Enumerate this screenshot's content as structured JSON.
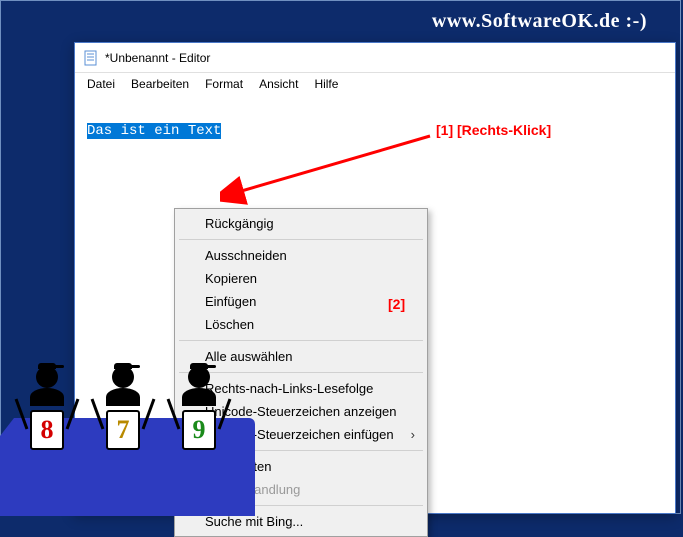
{
  "watermark": "www.SoftwareOK.de :-)",
  "window": {
    "title": "*Unbenannt - Editor"
  },
  "menubar": {
    "items": [
      "Datei",
      "Bearbeiten",
      "Format",
      "Ansicht",
      "Hilfe"
    ]
  },
  "editor": {
    "selected_text": "Das ist ein Text"
  },
  "context_menu": {
    "items": [
      {
        "label": "Rückgängig",
        "enabled": true
      },
      {
        "sep": true
      },
      {
        "label": "Ausschneiden",
        "enabled": true
      },
      {
        "label": "Kopieren",
        "enabled": true
      },
      {
        "label": "Einfügen",
        "enabled": true
      },
      {
        "label": "Löschen",
        "enabled": true
      },
      {
        "sep": true
      },
      {
        "label": "Alle auswählen",
        "enabled": true
      },
      {
        "sep": true
      },
      {
        "label": "Rechts-nach-Links-Lesefolge",
        "enabled": true
      },
      {
        "label": "Unicode-Steuerzeichen anzeigen",
        "enabled": true
      },
      {
        "label": "Unicode-Steuerzeichen einfügen",
        "enabled": true,
        "submenu": true
      },
      {
        "sep": true
      },
      {
        "label": "IME starten",
        "enabled": true
      },
      {
        "label": "Zurückwandlung",
        "enabled": false
      },
      {
        "sep": true
      },
      {
        "label": "Suche mit Bing...",
        "enabled": true
      }
    ]
  },
  "annotations": {
    "a1": "[1]   [Rechts-Klick]",
    "a2": "[2]"
  },
  "judges": {
    "scores": [
      "8",
      "7",
      "9"
    ]
  }
}
